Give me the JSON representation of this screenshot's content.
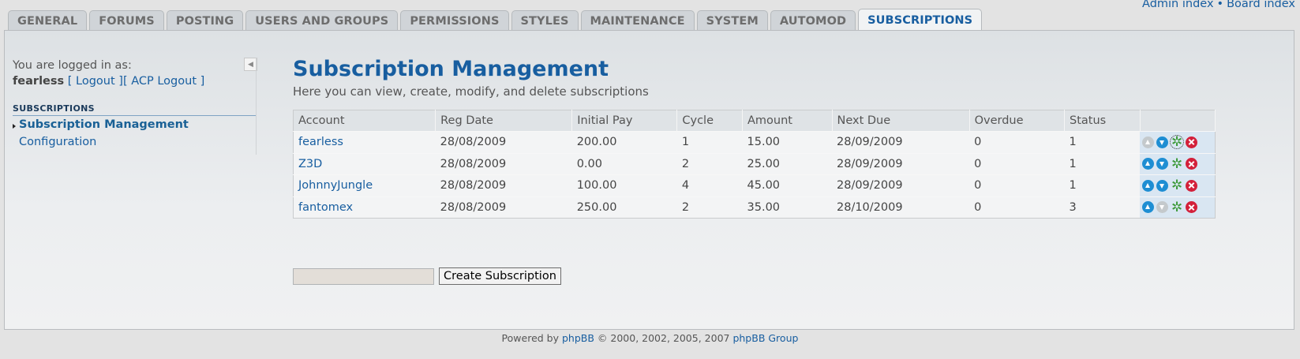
{
  "top_links": {
    "admin_index": "Admin index",
    "separator": "•",
    "board_index": "Board index"
  },
  "tabs": [
    {
      "label": "GENERAL"
    },
    {
      "label": "FORUMS"
    },
    {
      "label": "POSTING"
    },
    {
      "label": "USERS AND GROUPS"
    },
    {
      "label": "PERMISSIONS"
    },
    {
      "label": "STYLES"
    },
    {
      "label": "MAINTENANCE"
    },
    {
      "label": "SYSTEM"
    },
    {
      "label": "AUTOMOD"
    },
    {
      "label": "SUBSCRIPTIONS"
    }
  ],
  "sidebar": {
    "logged_in_text": "You are logged in as:",
    "username": "fearless",
    "logout_text": "[ Logout ]",
    "acp_logout_text": "[ ACP Logout ]",
    "collapse_glyph": "◀",
    "section_title": "SUBSCRIPTIONS",
    "items": [
      {
        "label": "Subscription Management"
      },
      {
        "label": "Configuration"
      }
    ]
  },
  "main": {
    "title": "Subscription Management",
    "description": "Here you can view, create, modify, and delete subscriptions",
    "columns": [
      "Account",
      "Reg Date",
      "Initial Pay",
      "Cycle",
      "Amount",
      "Next Due",
      "Overdue",
      "Status",
      ""
    ],
    "rows": [
      {
        "account": "fearless",
        "reg_date": "28/08/2009",
        "initial_pay": "200.00",
        "cycle": "1",
        "amount": "15.00",
        "next_due": "28/09/2009",
        "overdue": "0",
        "status": "1"
      },
      {
        "account": "Z3D",
        "reg_date": "28/08/2009",
        "initial_pay": "0.00",
        "cycle": "2",
        "amount": "25.00",
        "next_due": "28/09/2009",
        "overdue": "0",
        "status": "1"
      },
      {
        "account": "JohnnyJungle",
        "reg_date": "28/08/2009",
        "initial_pay": "100.00",
        "cycle": "4",
        "amount": "45.00",
        "next_due": "28/09/2009",
        "overdue": "0",
        "status": "1"
      },
      {
        "account": "fantomex",
        "reg_date": "28/08/2009",
        "initial_pay": "250.00",
        "cycle": "2",
        "amount": "35.00",
        "next_due": "28/10/2009",
        "overdue": "0",
        "status": "3"
      }
    ],
    "action_icons": {
      "up": "move-up-icon",
      "down": "move-down-icon",
      "edit": "gear-icon",
      "delete": "delete-icon"
    },
    "create_input_value": "",
    "create_button": "Create Subscription"
  },
  "footer": {
    "prefix": "Powered by ",
    "phpbb": "phpBB",
    "copyright": " © 2000, 2002, 2005, 2007 ",
    "group": "phpBB Group"
  }
}
